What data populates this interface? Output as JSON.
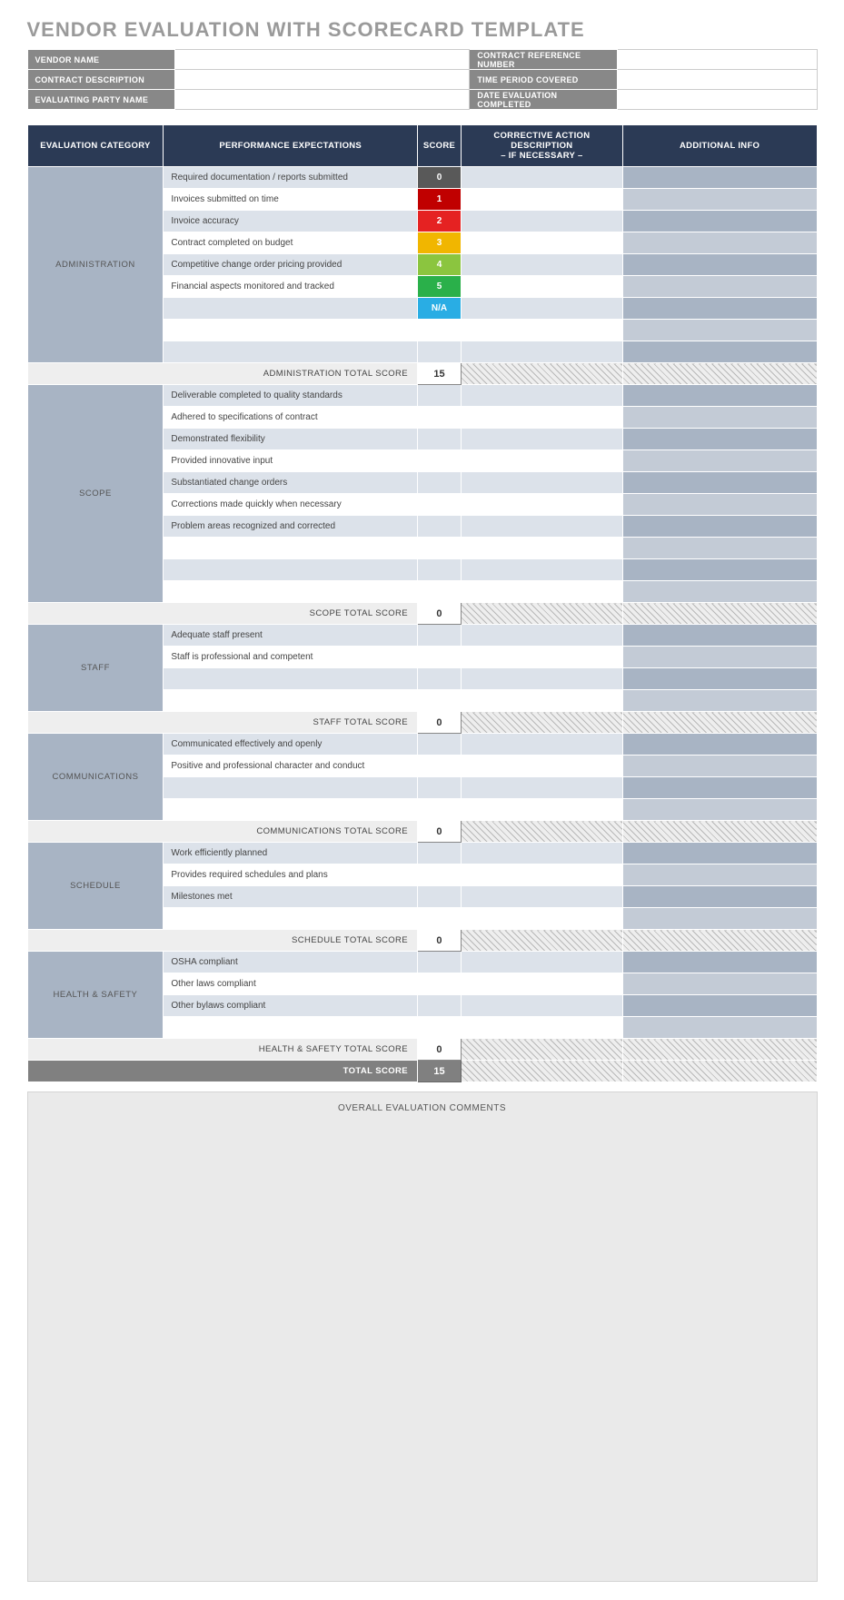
{
  "title": "VENDOR EVALUATION WITH SCORECARD TEMPLATE",
  "info": {
    "left": [
      {
        "label": "VENDOR NAME",
        "value": ""
      },
      {
        "label": "CONTRACT DESCRIPTION",
        "value": ""
      },
      {
        "label": "EVALUATING PARTY NAME",
        "value": ""
      }
    ],
    "right": [
      {
        "label": "CONTRACT REFERENCE NUMBER",
        "value": ""
      },
      {
        "label": "TIME PERIOD COVERED",
        "value": ""
      },
      {
        "label": "DATE EVALUATION COMPLETED",
        "value": ""
      }
    ]
  },
  "columns": {
    "category": "EVALUATION CATEGORY",
    "performance": "PERFORMANCE EXPECTATIONS",
    "score": "SCORE",
    "corrective_line1": "CORRECTIVE ACTION DESCRIPTION",
    "corrective_line2": "– IF NECESSARY –",
    "additional": "ADDITIONAL INFO"
  },
  "sections": [
    {
      "name": "ADMINISTRATION",
      "rows": [
        {
          "perf": "Required documentation / reports submitted",
          "score": "0",
          "score_class": "score-0"
        },
        {
          "perf": "Invoices submitted on time",
          "score": "1",
          "score_class": "score-1"
        },
        {
          "perf": "Invoice accuracy",
          "score": "2",
          "score_class": "score-2"
        },
        {
          "perf": "Contract completed on budget",
          "score": "3",
          "score_class": "score-3"
        },
        {
          "perf": "Competitive change order pricing provided",
          "score": "4",
          "score_class": "score-4"
        },
        {
          "perf": "Financial aspects monitored and tracked",
          "score": "5",
          "score_class": "score-5"
        },
        {
          "perf": "",
          "score": "N/A",
          "score_class": "score-na"
        },
        {
          "perf": "",
          "score": "",
          "score_class": ""
        },
        {
          "perf": "",
          "score": "",
          "score_class": ""
        }
      ],
      "total_label": "ADMINISTRATION TOTAL SCORE",
      "total": "15"
    },
    {
      "name": "SCOPE",
      "rows": [
        {
          "perf": "Deliverable completed to quality standards",
          "score": "",
          "score_class": ""
        },
        {
          "perf": "Adhered to specifications of contract",
          "score": "",
          "score_class": ""
        },
        {
          "perf": "Demonstrated flexibility",
          "score": "",
          "score_class": ""
        },
        {
          "perf": "Provided innovative input",
          "score": "",
          "score_class": ""
        },
        {
          "perf": "Substantiated change orders",
          "score": "",
          "score_class": ""
        },
        {
          "perf": "Corrections made quickly when necessary",
          "score": "",
          "score_class": ""
        },
        {
          "perf": "Problem areas recognized and corrected",
          "score": "",
          "score_class": ""
        },
        {
          "perf": "",
          "score": "",
          "score_class": ""
        },
        {
          "perf": "",
          "score": "",
          "score_class": ""
        },
        {
          "perf": "",
          "score": "",
          "score_class": ""
        }
      ],
      "total_label": "SCOPE TOTAL SCORE",
      "total": "0"
    },
    {
      "name": "STAFF",
      "rows": [
        {
          "perf": "Adequate staff present",
          "score": "",
          "score_class": ""
        },
        {
          "perf": "Staff is professional and competent",
          "score": "",
          "score_class": ""
        },
        {
          "perf": "",
          "score": "",
          "score_class": ""
        },
        {
          "perf": "",
          "score": "",
          "score_class": ""
        }
      ],
      "total_label": "STAFF TOTAL SCORE",
      "total": "0"
    },
    {
      "name": "COMMUNICATIONS",
      "rows": [
        {
          "perf": "Communicated effectively and openly",
          "score": "",
          "score_class": ""
        },
        {
          "perf": "Positive and professional character and conduct",
          "score": "",
          "score_class": ""
        },
        {
          "perf": "",
          "score": "",
          "score_class": ""
        },
        {
          "perf": "",
          "score": "",
          "score_class": ""
        }
      ],
      "total_label": "COMMUNICATIONS TOTAL SCORE",
      "total": "0"
    },
    {
      "name": "SCHEDULE",
      "rows": [
        {
          "perf": "Work efficiently planned",
          "score": "",
          "score_class": ""
        },
        {
          "perf": "Provides required schedules and plans",
          "score": "",
          "score_class": ""
        },
        {
          "perf": "Milestones met",
          "score": "",
          "score_class": ""
        },
        {
          "perf": "",
          "score": "",
          "score_class": ""
        }
      ],
      "total_label": "SCHEDULE TOTAL SCORE",
      "total": "0"
    },
    {
      "name": "HEALTH & SAFETY",
      "rows": [
        {
          "perf": "OSHA compliant",
          "score": "",
          "score_class": ""
        },
        {
          "perf": "Other laws compliant",
          "score": "",
          "score_class": ""
        },
        {
          "perf": "Other bylaws compliant",
          "score": "",
          "score_class": ""
        },
        {
          "perf": "",
          "score": "",
          "score_class": ""
        }
      ],
      "total_label": "HEALTH & SAFETY TOTAL SCORE",
      "total": "0"
    }
  ],
  "grand_total_label": "TOTAL SCORE",
  "grand_total": "15",
  "comments_label": "OVERALL EVALUATION COMMENTS"
}
